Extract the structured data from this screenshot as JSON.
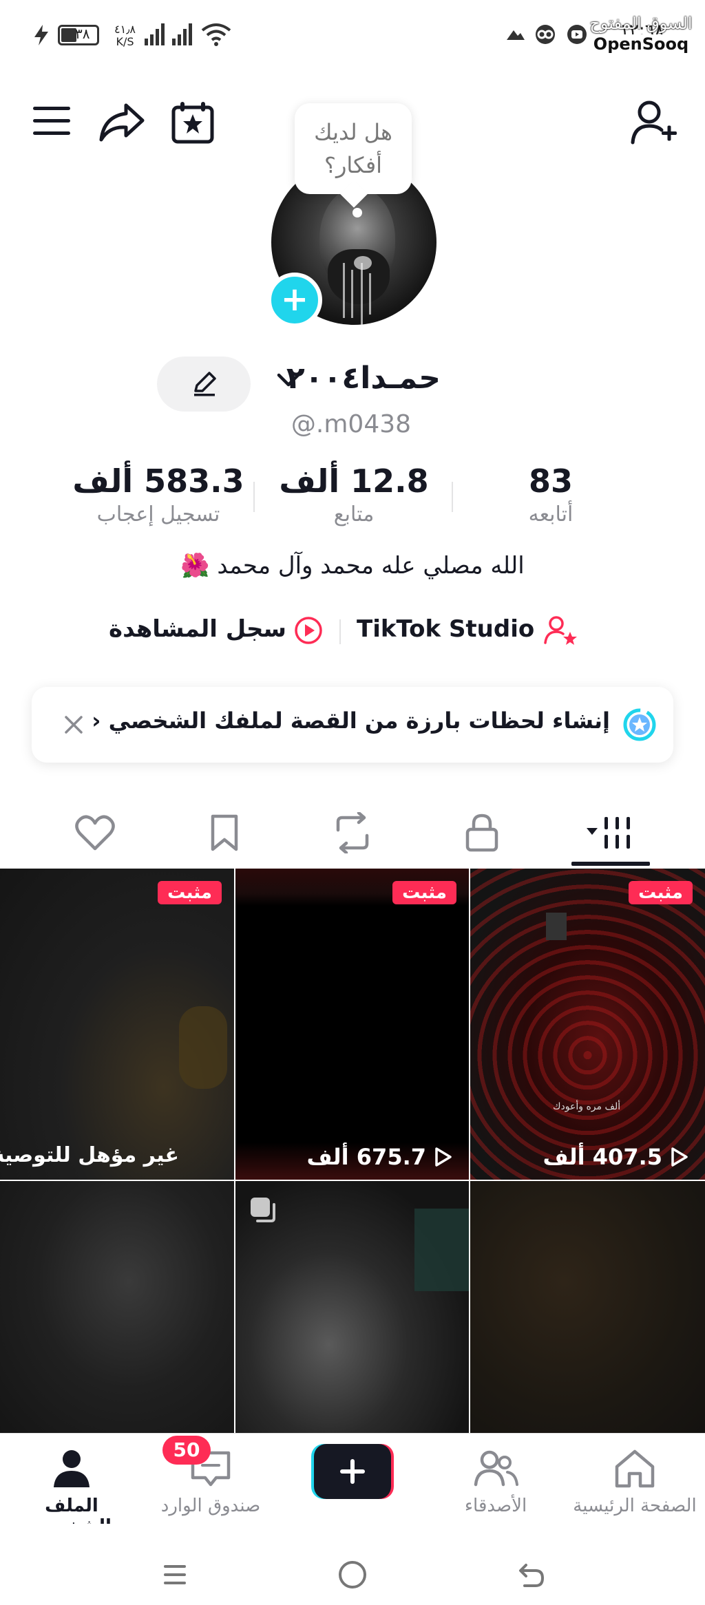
{
  "status_bar": {
    "time": "١٢:٦٨",
    "battery": "٣٨",
    "speed": "٤١٫٨",
    "speed_unit": "K/S",
    "watermark": "OpenSooq",
    "watermark_ar": "السوق المفتوح"
  },
  "profile": {
    "tooltip": "هل لديك أفكار؟",
    "name": "حمـدا٢٠٠٤",
    "handle": "@.m0438",
    "bio": "الله مصلي عله محمد وآل محمد 🌺"
  },
  "stats": [
    {
      "num": "583.3 ألف",
      "label": "تسجيل إعجاب"
    },
    {
      "num": "12.8 ألف",
      "label": "متابع"
    },
    {
      "num": "83",
      "label": "أتابعه"
    }
  ],
  "links": {
    "studio": "TikTok Studio",
    "history": "سجل المشاهدة"
  },
  "banner": {
    "text": "إنشاء لحظات بارزة من القصة لملفك الشخصي ‹"
  },
  "grid": {
    "pinned_label": "مثبت",
    "items": [
      {
        "views": "407.5 ألف"
      },
      {
        "views": "675.7 ألف"
      },
      {
        "label": "غير مؤهل للتوصية"
      }
    ],
    "overlay_caption": "ألف مره وأعودك"
  },
  "bottom_nav": {
    "home": "الصفحة الرئيسية",
    "friends": "الأصدقاء",
    "inbox": "صندوق الوارد",
    "inbox_badge": "50",
    "profile": "الملف الشخصي"
  },
  "colors": {
    "accent": "#fe2c55",
    "cyan": "#20d5ec",
    "text": "#161823",
    "muted": "#8a8b91"
  }
}
